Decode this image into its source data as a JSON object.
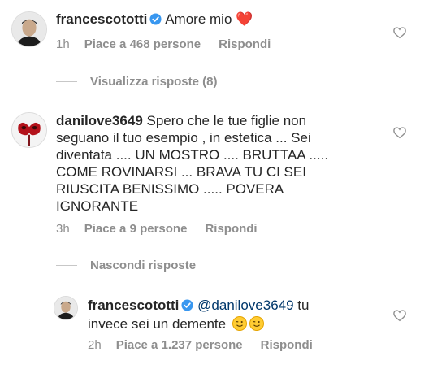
{
  "comments": [
    {
      "username": "francescototti",
      "verified": true,
      "text": "Amore mio",
      "emoji": "❤️",
      "time": "1h",
      "likes": "Piace a 468 persone",
      "reply": "Rispondi",
      "replies_toggle": "Visualizza risposte (8)"
    },
    {
      "username": "danilove3649",
      "text": "Spero che le tue figlie non seguano il tuo esempio , in estetica ... Sei diventata .... UN MOSTRO .... BRUTTAA ..... COME ROVINARSI ... BRAVA TU CI SEI RIUSCITA BENISSIMO ..... POVERA IGNORANTE",
      "time": "3h",
      "likes": "Piace a 9 persone",
      "reply": "Rispondi",
      "replies_toggle": "Nascondi risposte"
    }
  ],
  "reply": {
    "username": "francescototti",
    "verified": true,
    "mention": "@danilove3649",
    "text": "tu invece sei un demente",
    "time": "2h",
    "likes": "Piace a 1.237 persone",
    "reply": "Rispondi"
  },
  "colors": {
    "text": "#262626",
    "meta": "#8e8e8e",
    "verified": "#3897f0",
    "heart": "#ed4956",
    "mention": "#00376b"
  },
  "icons": [
    "heart-outline-icon",
    "verified-badge-icon",
    "red-mask-avatar",
    "profile-avatar"
  ]
}
